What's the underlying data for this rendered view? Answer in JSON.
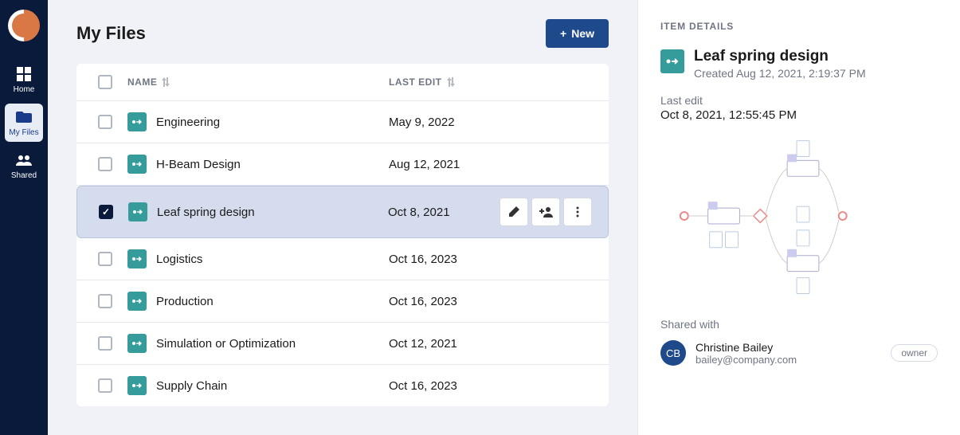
{
  "sidebar": {
    "nav": [
      {
        "label": "Home",
        "icon": "home-dashboard-icon",
        "active": false
      },
      {
        "label": "My Files",
        "icon": "files-icon",
        "active": true
      },
      {
        "label": "Shared",
        "icon": "shared-icon",
        "active": false
      }
    ]
  },
  "header": {
    "title": "My Files",
    "new_btn": "New"
  },
  "table": {
    "columns": {
      "name": "NAME",
      "last_edit": "LAST EDIT"
    },
    "rows": [
      {
        "name": "Engineering",
        "last_edit": "May 9, 2022",
        "selected": false
      },
      {
        "name": "H-Beam Design",
        "last_edit": "Aug 12, 2021",
        "selected": false
      },
      {
        "name": "Leaf spring design",
        "last_edit": "Oct 8, 2021",
        "selected": true
      },
      {
        "name": "Logistics",
        "last_edit": "Oct 16, 2023",
        "selected": false
      },
      {
        "name": "Production",
        "last_edit": "Oct 16, 2023",
        "selected": false
      },
      {
        "name": "Simulation or Optimization",
        "last_edit": "Oct 12, 2021",
        "selected": false
      },
      {
        "name": "Supply Chain",
        "last_edit": "Oct 16, 2023",
        "selected": false
      }
    ]
  },
  "details": {
    "header": "ITEM DETAILS",
    "title": "Leaf spring design",
    "created_label": "Created",
    "created_value": "Aug 12, 2021, 2:19:37 PM",
    "last_edit_label": "Last edit",
    "last_edit_value": "Oct 8, 2021, 12:55:45 PM",
    "shared_label": "Shared with",
    "shared": [
      {
        "initials": "CB",
        "name": "Christine Bailey",
        "email": "bailey@company.com",
        "role": "owner"
      }
    ]
  }
}
